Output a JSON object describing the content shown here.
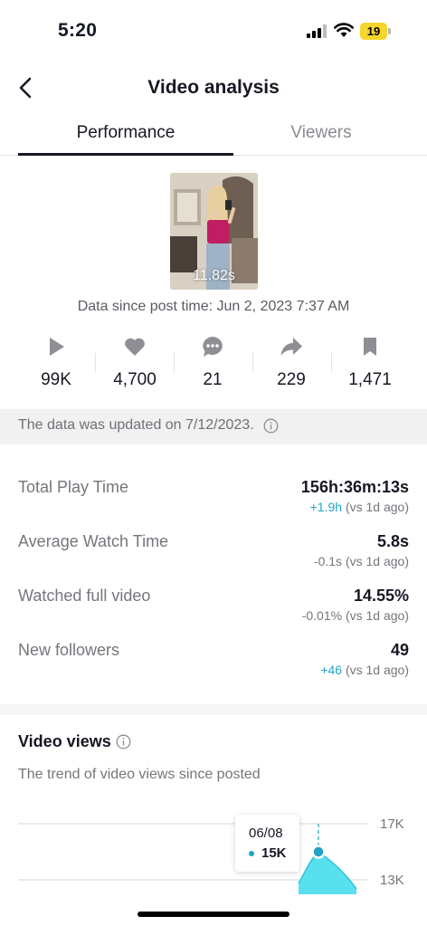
{
  "status_bar": {
    "time": "5:20",
    "battery": "19"
  },
  "header": {
    "title": "Video analysis"
  },
  "tabs": [
    {
      "label": "Performance",
      "active": true
    },
    {
      "label": "Viewers",
      "active": false
    }
  ],
  "video": {
    "duration": "11.82s",
    "data_since": "Data since post time: Jun 2, 2023 7:37 AM"
  },
  "metrics": [
    {
      "icon": "play-icon",
      "value": "99K"
    },
    {
      "icon": "heart-icon",
      "value": "4,700"
    },
    {
      "icon": "comment-icon",
      "value": "21"
    },
    {
      "icon": "share-icon",
      "value": "229"
    },
    {
      "icon": "bookmark-icon",
      "value": "1,471"
    }
  ],
  "update_notice": "The data was updated on 7/12/2023.",
  "stats": [
    {
      "label": "Total Play Time",
      "value": "156h:36m:13s",
      "delta": "+1.9h",
      "delta_suffix": " (vs 1d ago)",
      "delta_color": "#20a6c4"
    },
    {
      "label": "Average Watch Time",
      "value": "5.8s",
      "delta": "-0.1s",
      "delta_suffix": " (vs 1d ago)",
      "delta_color": "#75767c"
    },
    {
      "label": "Watched full video",
      "value": "14.55%",
      "delta": "-0.01%",
      "delta_suffix": " (vs 1d ago)",
      "delta_color": "#75767c"
    },
    {
      "label": "New followers",
      "value": "49",
      "delta": "+46",
      "delta_suffix": " (vs 1d ago)",
      "delta_color": "#20a6c4"
    }
  ],
  "video_views": {
    "title": "Video views",
    "subtitle": "The trend of video views since posted",
    "y_ticks": [
      "17K",
      "13K"
    ],
    "tooltip": {
      "date": "06/08",
      "value": "15K"
    }
  },
  "colors": {
    "accent": "#20a6c4",
    "chart_fill": "#59e0ef",
    "text": "#161823",
    "muted": "#75767c"
  }
}
